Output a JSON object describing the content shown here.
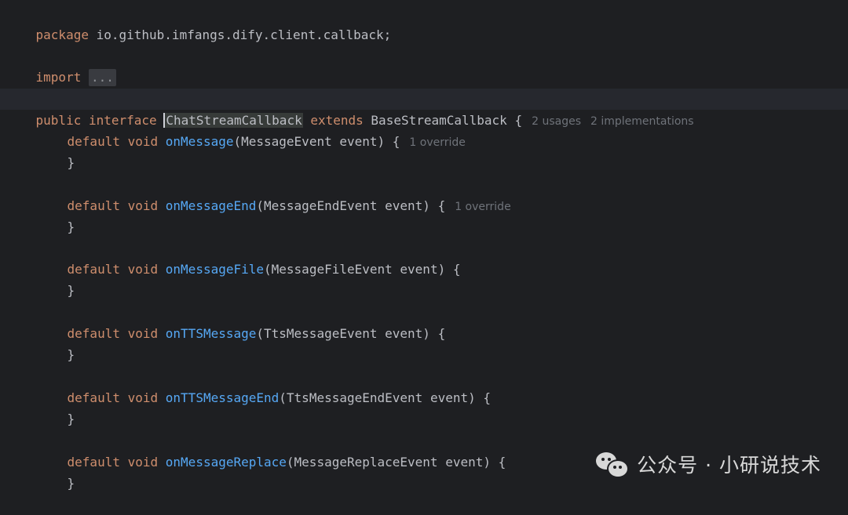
{
  "code": {
    "package_kw": "package",
    "package_name": " io.github.imfangs.dify.client.callback;",
    "import_kw": "import",
    "import_folded": "...",
    "decl": {
      "public": "public",
      "interface": "interface",
      "name": "ChatStreamCallback",
      "extends": "extends",
      "base": "BaseStreamCallback",
      "open": "{",
      "usages_hint": "2 usages",
      "impl_hint": "2 implementations"
    },
    "kw_default": "default",
    "kw_void": "void",
    "close_brace": "}",
    "methods": [
      {
        "name": "onMessage",
        "params": "(MessageEvent event) {",
        "hint": "1 override"
      },
      {
        "name": "onMessageEnd",
        "params": "(MessageEndEvent event) {",
        "hint": "1 override"
      },
      {
        "name": "onMessageFile",
        "params": "(MessageFileEvent event) {",
        "hint": ""
      },
      {
        "name": "onTTSMessage",
        "params": "(TtsMessageEvent event) {",
        "hint": ""
      },
      {
        "name": "onTTSMessageEnd",
        "params": "(TtsMessageEndEvent event) {",
        "hint": ""
      },
      {
        "name": "onMessageReplace",
        "params": "(MessageReplaceEvent event) {",
        "hint": ""
      }
    ]
  },
  "watermark": {
    "text": "公众号 · 小研说技术",
    "icon": "wechat-icon"
  },
  "colors": {
    "background": "#1e1f22",
    "keyword": "#cf8e6d",
    "function": "#56a8f5",
    "text": "#bcbec4",
    "hint": "#6f737a"
  }
}
